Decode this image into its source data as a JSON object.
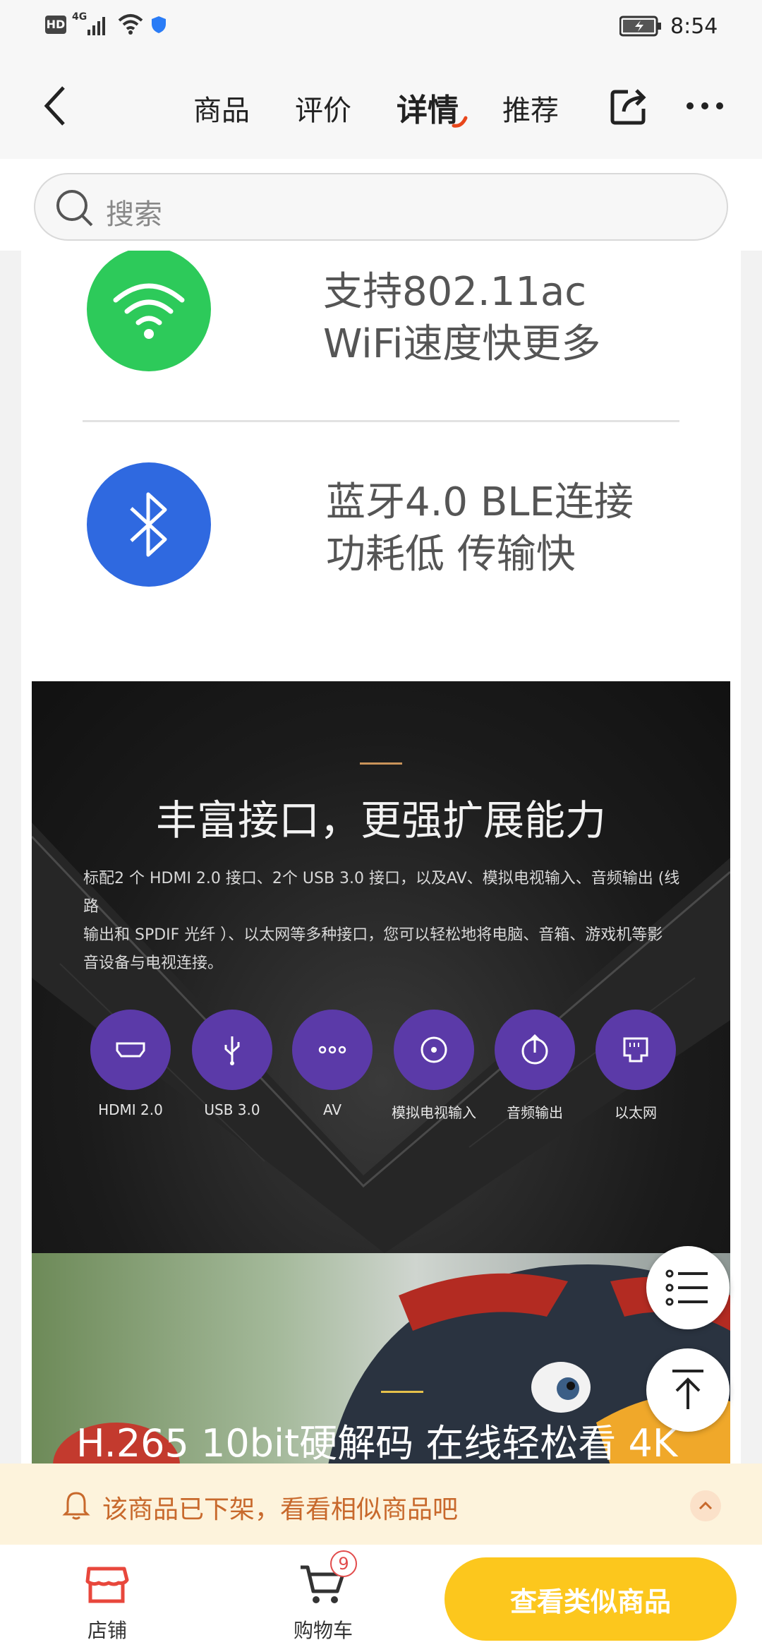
{
  "status_bar": {
    "left_icons": [
      "hd-icon",
      "4g-signal-icon",
      "wifi-icon",
      "shield-icon"
    ],
    "hd": "HD",
    "network": "4G",
    "time": "8:54",
    "battery_icon": "battery-charging-icon"
  },
  "nav": {
    "back_icon": "chevron-left-icon",
    "tabs": [
      {
        "label": "商品",
        "active": false
      },
      {
        "label": "评价",
        "active": false
      },
      {
        "label": "详情",
        "active": true
      },
      {
        "label": "推荐",
        "active": false
      }
    ],
    "share_icon": "share-icon",
    "more_icon": "more-dots-icon",
    "active_indicator_color": "#e8471c"
  },
  "search": {
    "placeholder": "搜索",
    "icon": "search-icon"
  },
  "features": [
    {
      "icon": "wifi-icon",
      "color": "#2dca5a",
      "line1": "支持802.11ac",
      "line2": "WiFi速度快更多"
    },
    {
      "icon": "bluetooth-icon",
      "color": "#2f69e0",
      "line1": "蓝牙4.0 BLE连接",
      "line2": "功耗低 传输快"
    }
  ],
  "interfaces": {
    "title": "丰富接口，更强扩展能力",
    "description_lines": [
      "标配2 个 HDMI 2.0 接口、2个 USB 3.0 接口，以及AV、模拟电视输入、音频输出 (线路",
      "输出和  SPDIF 光纤 ）、以太网等多种接口，您可以轻松地将电脑、音箱、游戏机等影",
      "音设备与电视连接。"
    ],
    "ports": [
      {
        "label": "HDMI 2.0",
        "icon": "hdmi-port-icon"
      },
      {
        "label": "USB 3.0",
        "icon": "usb-icon"
      },
      {
        "label": "AV",
        "icon": "av-dots-icon"
      },
      {
        "label": "模拟电视输入",
        "icon": "circle-dot-icon"
      },
      {
        "label": "音频输出",
        "icon": "audio-out-icon"
      },
      {
        "label": "以太网",
        "icon": "ethernet-icon"
      }
    ],
    "accent_color": "#c9935a",
    "port_color": "#5b3aa8"
  },
  "decoding": {
    "title": "H.265 10bit硬解码 在线轻松看 4K"
  },
  "floating": {
    "list_icon": "list-icon",
    "top_icon": "back-to-top-icon"
  },
  "notice": {
    "icon": "bell-icon",
    "text": "该商品已下架，看看相似商品吧",
    "expand_icon": "chevron-up-icon"
  },
  "bottom_bar": {
    "store_label": "店铺",
    "store_icon": "store-icon",
    "cart_label": "购物车",
    "cart_icon": "cart-icon",
    "cart_count": "9",
    "cta_label": "查看类似商品",
    "cta_color": "#fcc71d"
  }
}
